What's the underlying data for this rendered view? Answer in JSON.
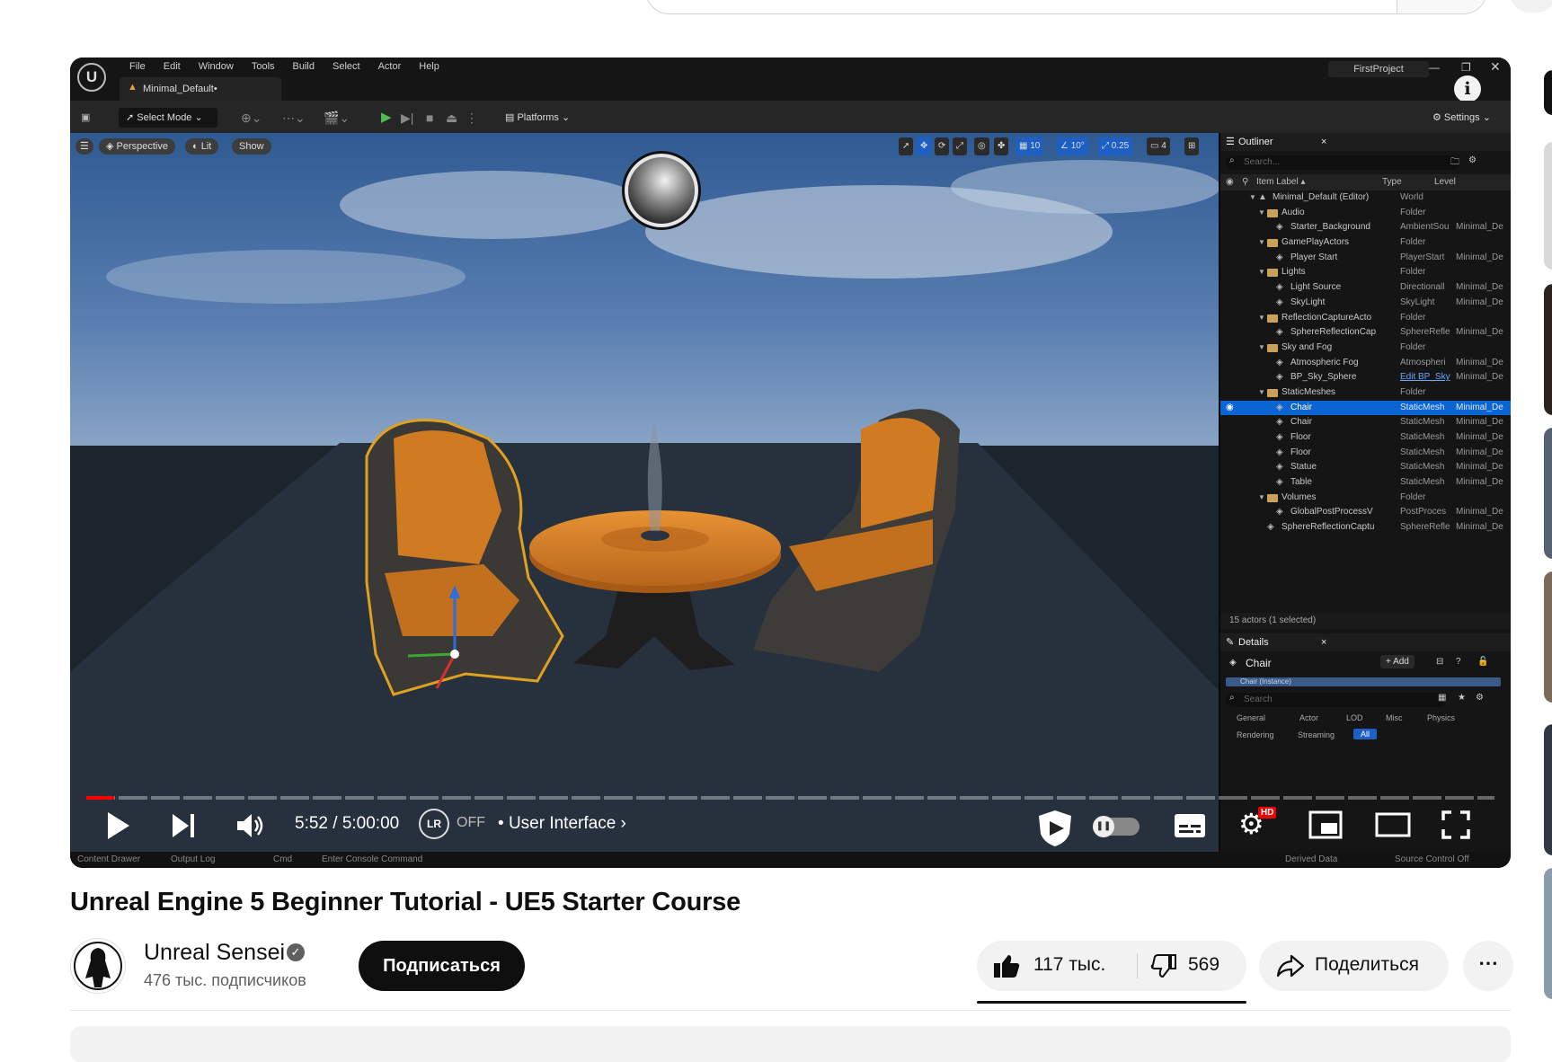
{
  "editor": {
    "menu": [
      "File",
      "Edit",
      "Window",
      "Tools",
      "Build",
      "Select",
      "Actor",
      "Help"
    ],
    "level_tab": "Minimal_Default•",
    "project_name": "FirstProject",
    "toolbar": {
      "select_mode": "Select Mode",
      "platforms": "Platforms",
      "settings": "Settings"
    },
    "viewport": {
      "perspective": "Perspective",
      "lit": "Lit",
      "show": "Show",
      "grid_snap": "10",
      "rot_snap": "10°",
      "scale_snap": "0.25",
      "camera_speed": "4"
    },
    "outliner": {
      "title": "Outliner",
      "search_placeholder": "Search...",
      "col_label": "Item Label ▴",
      "col_type": "Type",
      "col_level": "Level",
      "rows": [
        {
          "label": "Minimal_Default (Editor)",
          "type": "World",
          "level": ""
        },
        {
          "label": "Audio",
          "type": "Folder",
          "level": ""
        },
        {
          "label": "Starter_Background",
          "type": "AmbientSou",
          "level": "Minimal_De"
        },
        {
          "label": "GamePlayActors",
          "type": "Folder",
          "level": ""
        },
        {
          "label": "Player Start",
          "type": "PlayerStart",
          "level": "Minimal_De"
        },
        {
          "label": "Lights",
          "type": "Folder",
          "level": ""
        },
        {
          "label": "Light Source",
          "type": "Directionall",
          "level": "Minimal_De"
        },
        {
          "label": "SkyLight",
          "type": "SkyLight",
          "level": "Minimal_De"
        },
        {
          "label": "ReflectionCaptureActo",
          "type": "Folder",
          "level": ""
        },
        {
          "label": "SphereReflectionCap",
          "type": "SphereRefle",
          "level": "Minimal_De"
        },
        {
          "label": "Sky and Fog",
          "type": "Folder",
          "level": ""
        },
        {
          "label": "Atmospheric Fog",
          "type": "Atmospheri",
          "level": "Minimal_De"
        },
        {
          "label": "BP_Sky_Sphere",
          "type": "Edit BP_Sky",
          "level": "Minimal_De"
        },
        {
          "label": "StaticMeshes",
          "type": "Folder",
          "level": ""
        },
        {
          "label": "Chair",
          "type": "StaticMesh",
          "level": "Minimal_De"
        },
        {
          "label": "Chair",
          "type": "StaticMesh",
          "level": "Minimal_De"
        },
        {
          "label": "Floor",
          "type": "StaticMesh",
          "level": "Minimal_De"
        },
        {
          "label": "Floor",
          "type": "StaticMesh",
          "level": "Minimal_De"
        },
        {
          "label": "Statue",
          "type": "StaticMesh",
          "level": "Minimal_De"
        },
        {
          "label": "Table",
          "type": "StaticMesh",
          "level": "Minimal_De"
        },
        {
          "label": "Volumes",
          "type": "Folder",
          "level": ""
        },
        {
          "label": "GlobalPostProcessV",
          "type": "PostProces",
          "level": "Minimal_De"
        },
        {
          "label": "SphereReflectionCaptu",
          "type": "SphereRefle",
          "level": "Minimal_De"
        }
      ],
      "status": "15 actors (1 selected)"
    },
    "details": {
      "title": "Details",
      "selected": "Chair",
      "add": "+ Add",
      "instance": "Chair (Instance)",
      "search_placeholder": "Search",
      "filters_row1": [
        "General",
        "Actor",
        "LOD",
        "Misc",
        "Physics"
      ],
      "filters_row2": [
        "Rendering",
        "Streaming",
        "All"
      ]
    },
    "status_bar": {
      "content_drawer": "Content Drawer",
      "output_log": "Output Log",
      "cmd": "Cmd",
      "console_placeholder": "Enter Console Command",
      "derived_data": "Derived Data",
      "source_control": "Source Control Off"
    }
  },
  "player": {
    "time": "5:52 / 5:00:00",
    "lr_toggle": "OFF",
    "chapter": "User Interface",
    "quality_badge": "HD",
    "progress_fraction": 0.0196
  },
  "video": {
    "title": "Unreal Engine 5 Beginner Tutorial - UE5 Starter Course",
    "channel": "Unreal Sensei",
    "subscribers": "476 тыс. подписчиков",
    "subscribe_label": "Подписаться",
    "likes": "117 тыс.",
    "dislikes": "569",
    "share_label": "Поделиться"
  },
  "colors": {
    "accent_red": "#ff0000",
    "selection_blue": "#0a64d2",
    "chair_orange": "#d77a1c"
  }
}
